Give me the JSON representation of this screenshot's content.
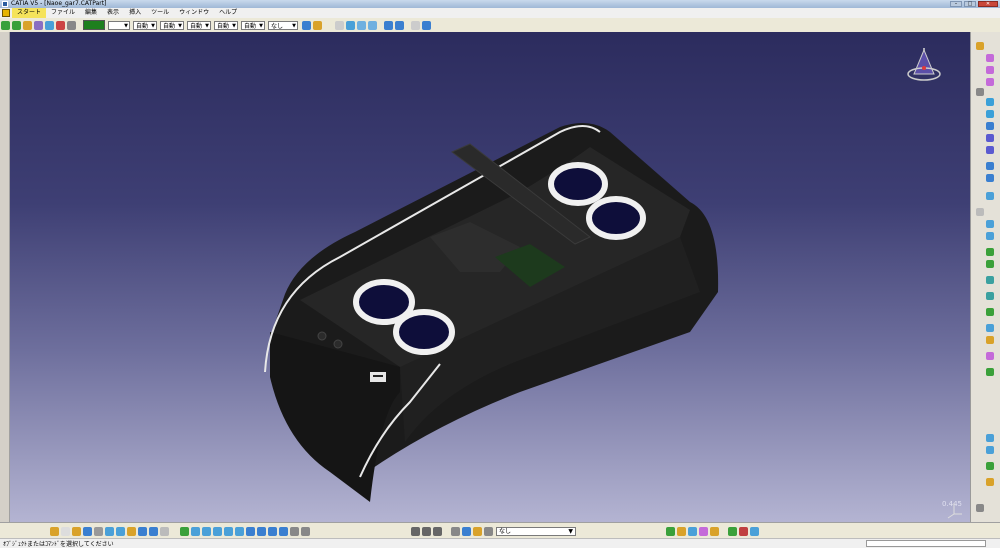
{
  "window": {
    "title": "CATIA V5 - [Naoe_gar7.CATPart]",
    "min": "–",
    "max": "□",
    "close": "✕"
  },
  "menu": {
    "items": [
      "スタート",
      "ファイル",
      "編集",
      "表示",
      "挿入",
      "ツール",
      "ウィンドウ",
      "ヘルプ"
    ]
  },
  "toolbar": {
    "color_swatch": "#1e7f1e",
    "combos": [
      {
        "value": "自動"
      },
      {
        "value": "自動"
      },
      {
        "value": "自動"
      },
      {
        "value": "自動"
      },
      {
        "value": "自動"
      },
      {
        "value": "なし"
      }
    ]
  },
  "viewport": {
    "scale_readout": "0.445",
    "axis_label": "x"
  },
  "bottom": {
    "layer_combo": "なし"
  },
  "status": {
    "prompt": "ｵﾌﾞｼﾞｪｸﾄまたはｺﾏﾝﾄﾞを選択してください"
  },
  "colors": {
    "bg_top": "#2c2c5e",
    "bg_bottom": "#b4b4d2",
    "model": "#1b1b1b",
    "rim": "#e8e8e8",
    "green_panel": "#1d3a1d"
  }
}
